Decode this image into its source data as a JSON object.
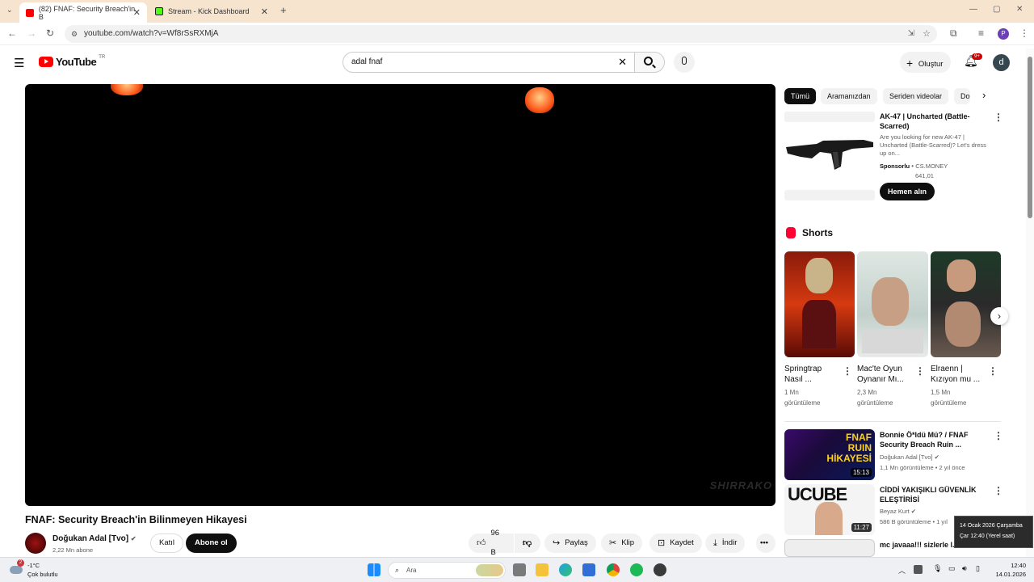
{
  "browser": {
    "tabs": [
      {
        "title": "(82) FNAF: Security Breach'in B",
        "active": true
      },
      {
        "title": "Stream - Kick Dashboard",
        "active": false
      }
    ],
    "url": "youtube.com/watch?v=Wf8rSsRXMjA"
  },
  "youtube": {
    "logo_text": "YouTube",
    "logo_country": "TR",
    "search_value": "adal fnaf",
    "create_label": "Oluştur",
    "notif_count": "9+",
    "avatar_letter": "d"
  },
  "video": {
    "title": "FNAF: Security Breach'in Bilinmeyen Hikayesi",
    "watermark": "SHIRRAKO",
    "channel_name": "Doğukan Adal [Tvo]",
    "subscribers": "2,22 Mn abone",
    "join_label": "Katıl",
    "subscribe_label": "Abone ol",
    "likes": "96 B",
    "share_label": "Paylaş",
    "clip_label": "Klip",
    "save_label": "Kaydet",
    "download_label": "İndir"
  },
  "sidebar": {
    "chips": [
      "Tümü",
      "Aramanızdan",
      "Seriden videolar",
      "Do"
    ],
    "ad": {
      "title": "AK-47 | Uncharted (Battle-Scarred)",
      "desc": "Are you looking for new AK-47 | Uncharted (Battle-Scarred)? Let's dress up on...",
      "sponsor": "Sponsorlu",
      "advertiser": "CS.MONEY",
      "views": "641,01",
      "cta": "Hemen alın"
    },
    "shorts_header": "Shorts",
    "shorts": [
      {
        "title": "Springtrap Nasıl ...",
        "views": "1 Mn",
        "views_label": "görüntüleme"
      },
      {
        "title": "Mac'te Oyun Oynanır Mı...",
        "views": "2,3 Mn",
        "views_label": "görüntüleme"
      },
      {
        "title": "Elraenn | Kızıyon mu ...",
        "views": "1,5 Mn",
        "views_label": "görüntüleme"
      }
    ],
    "videos": [
      {
        "title": "Bonnie Ö*ldü Mü? / FNAF Security Breach Ruin ...",
        "channel": "Doğukan Adal [Tvo]",
        "meta": "1,1 Mn görüntüleme • 2 yıl önce",
        "duration": "15:13",
        "thumb_text": "FNAF RUIN HİKAYESİ"
      },
      {
        "title": "CİDDİ YAKIŞIKLI GÜVENLİK ELEŞTİRİSİ",
        "channel": "Beyaz Kurt",
        "meta": "586 B görüntüleme • 1 yıl",
        "duration": "11:27",
        "thumb_text": "UCUBE"
      },
      {
        "title": "mc javaaa!!! sizlerle l... STEAL",
        "channel": "",
        "meta": "",
        "duration": "",
        "thumb_text": ""
      }
    ]
  },
  "taskbar": {
    "weather_temp": "-1°C",
    "weather_desc": "Çok bulutlu",
    "search_placeholder": "Ara",
    "time": "12:40",
    "date": "14.01.2026",
    "tooltip_line1": "14 Ocak 2026 Çarşamba",
    "tooltip_line2": "Çar 12:40 (Yerel saat)",
    "weather_badge": "2"
  },
  "colors": {
    "yt_red": "#ff0000",
    "tab_bar": "#f7e4cf",
    "taskbar": "#eef0f4"
  }
}
